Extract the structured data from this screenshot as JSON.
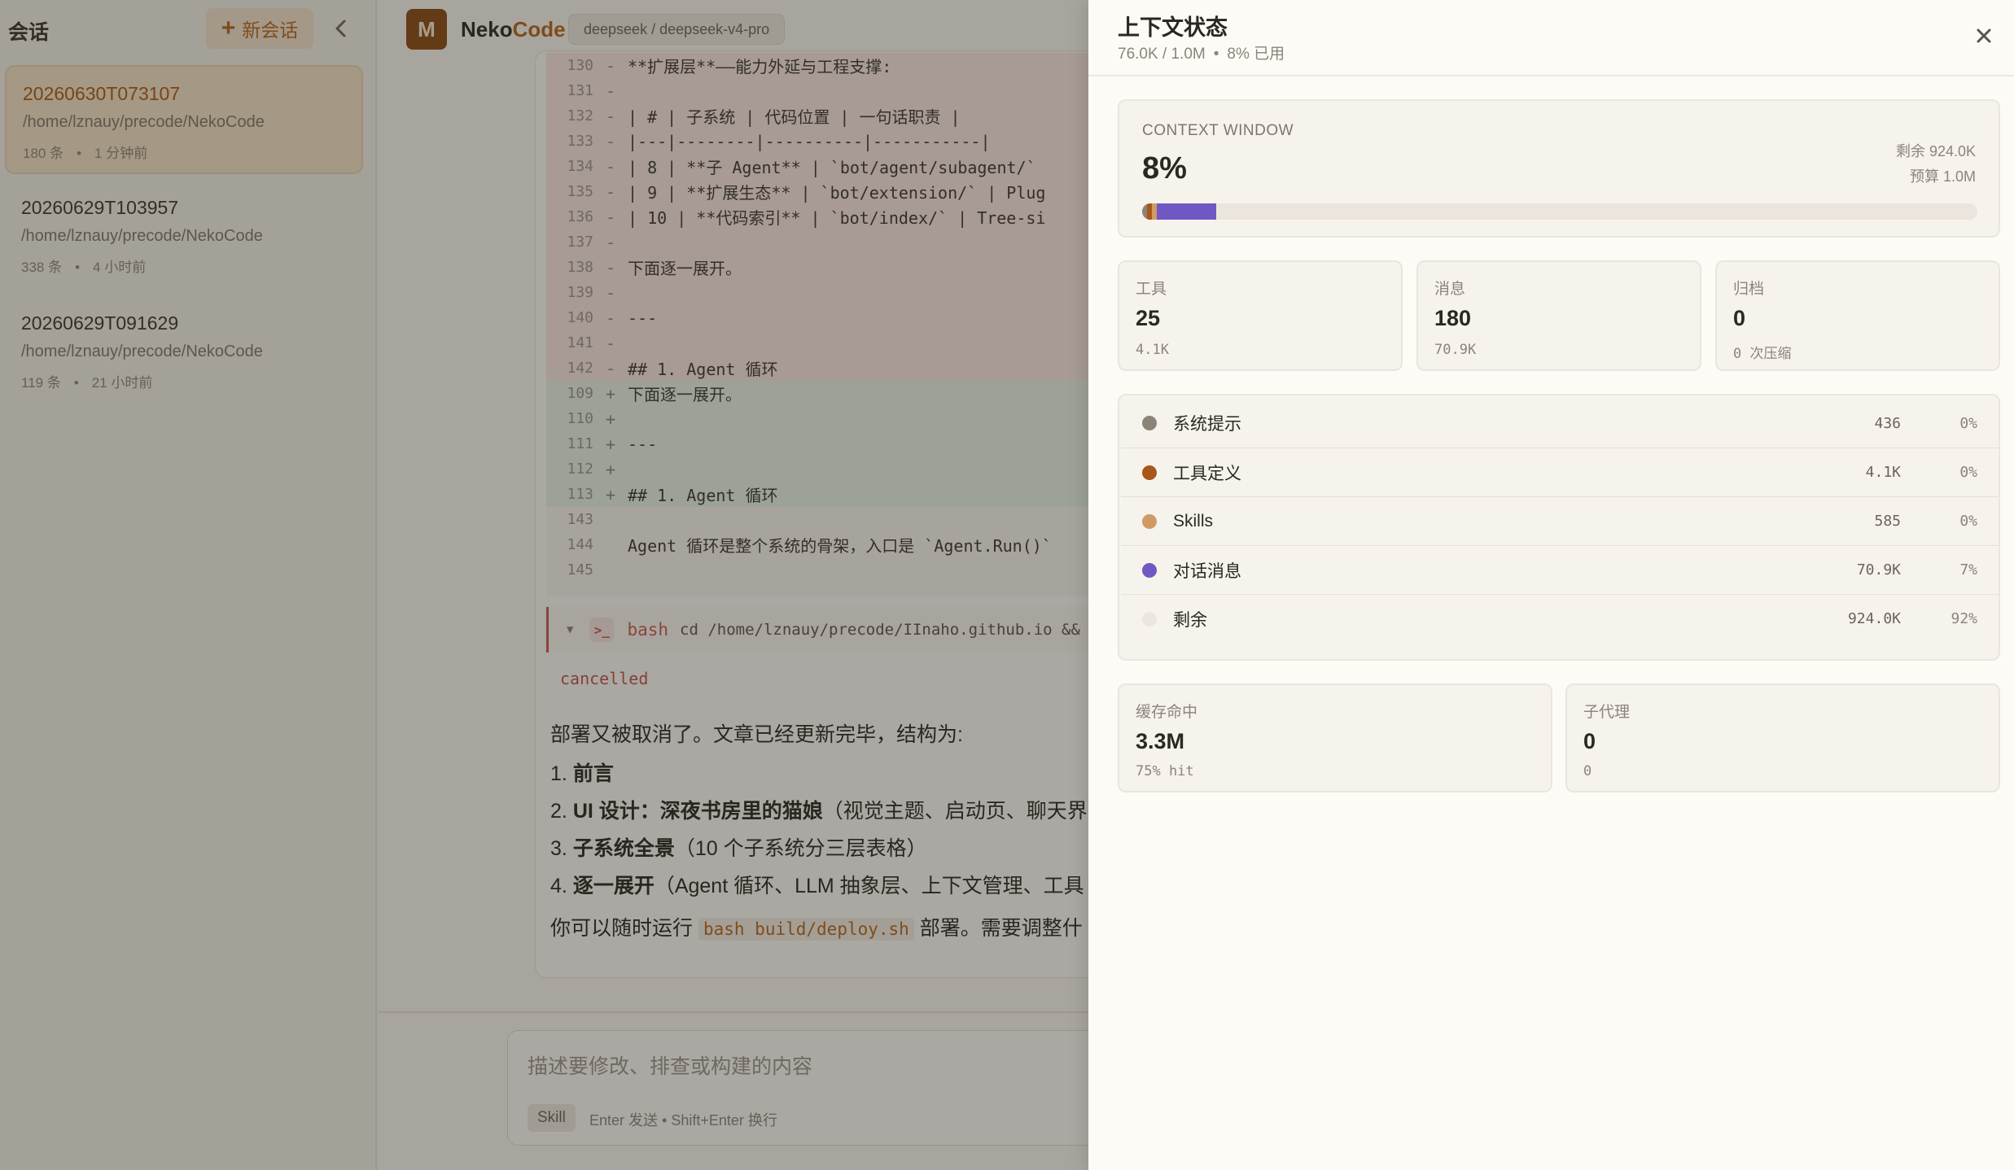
{
  "sidebar": {
    "title": "会话",
    "new_button": "新会话",
    "sessions": [
      {
        "title": "20260630T073107",
        "path": "/home/lznauy/precode/NekoCode",
        "count": "180 条",
        "time": "1 分钟前"
      },
      {
        "title": "20260629T103957",
        "path": "/home/lznauy/precode/NekoCode",
        "count": "338 条",
        "time": "4 小时前"
      },
      {
        "title": "20260629T091629",
        "path": "/home/lznauy/precode/NekoCode",
        "count": "119 条",
        "time": "21 小时前"
      }
    ]
  },
  "header": {
    "logo": "M",
    "brand_a": "Neko",
    "brand_b": "Code",
    "model": "deepseek / deepseek-v4-pro"
  },
  "diff": [
    {
      "ln": "130",
      "sign": "-",
      "code": "**扩展层**——能力外延与工程支撑:",
      "type": "del"
    },
    {
      "ln": "131",
      "sign": "-",
      "code": "",
      "type": "del"
    },
    {
      "ln": "132",
      "sign": "-",
      "code": "| # | 子系统 | 代码位置 | 一句话职责 |",
      "type": "del"
    },
    {
      "ln": "133",
      "sign": "-",
      "code": "|---|--------|----------|-----------|",
      "type": "del"
    },
    {
      "ln": "134",
      "sign": "-",
      "code": "| 8 | **子 Agent** | `bot/agent/subagent/`",
      "type": "del"
    },
    {
      "ln": "135",
      "sign": "-",
      "code": "| 9 | **扩展生态** | `bot/extension/` | Plug",
      "type": "del"
    },
    {
      "ln": "136",
      "sign": "-",
      "code": "| 10 | **代码索引** | `bot/index/` | Tree-si",
      "type": "del"
    },
    {
      "ln": "137",
      "sign": "-",
      "code": "",
      "type": "del"
    },
    {
      "ln": "138",
      "sign": "-",
      "code": "下面逐一展开。",
      "type": "del"
    },
    {
      "ln": "139",
      "sign": "-",
      "code": "",
      "type": "del"
    },
    {
      "ln": "140",
      "sign": "-",
      "code": "---",
      "type": "del"
    },
    {
      "ln": "141",
      "sign": "-",
      "code": "",
      "type": "del"
    },
    {
      "ln": "142",
      "sign": "-",
      "code": "## 1. Agent 循环",
      "type": "del"
    },
    {
      "ln": "109",
      "sign": "+",
      "code": "下面逐一展开。",
      "type": "add"
    },
    {
      "ln": "110",
      "sign": "+",
      "code": "",
      "type": "add"
    },
    {
      "ln": "111",
      "sign": "+",
      "code": "---",
      "type": "add"
    },
    {
      "ln": "112",
      "sign": "+",
      "code": "",
      "type": "add"
    },
    {
      "ln": "113",
      "sign": "+",
      "code": "## 1. Agent 循环",
      "type": "add"
    },
    {
      "ln": "143",
      "sign": "",
      "code": "",
      "type": "ctx"
    },
    {
      "ln": "144",
      "sign": "",
      "code": "Agent 循环是整个系统的骨架，入口是 `Agent.Run()`",
      "type": "ctx"
    },
    {
      "ln": "145",
      "sign": "",
      "code": "",
      "type": "ctx"
    }
  ],
  "tool": {
    "name": "bash",
    "command": "cd /home/lznauy/precode/IInaho.github.io &&",
    "status": "cancelled"
  },
  "answer": {
    "intro": "部署又被取消了。文章已经更新完毕，结构为:",
    "items": [
      {
        "num": "1.",
        "bold": "前言",
        "rest": ""
      },
      {
        "num": "2.",
        "bold": "UI 设计：深夜书房里的猫娘",
        "rest": "（视觉主题、启动页、聊天界"
      },
      {
        "num": "3.",
        "bold": "子系统全景",
        "rest": "（10 个子系统分三层表格）"
      },
      {
        "num": "4.",
        "bold": "逐一展开",
        "rest": "（Agent 循环、LLM 抽象层、上下文管理、工具"
      }
    ],
    "outro_pre": "你可以随时运行",
    "outro_code": "bash build/deploy.sh",
    "outro_post": "部署。需要调整什"
  },
  "composer": {
    "placeholder": "描述要修改、排查或构建的内容",
    "skill": "Skill",
    "hint": "Enter 发送 • Shift+Enter 换行"
  },
  "panel": {
    "title": "上下文状态",
    "used": "76.0K / 1.0M",
    "used_pct": "8% 已用",
    "close_icon": "close-icon",
    "window": {
      "label": "CONTEXT WINDOW",
      "percent": "8%",
      "remaining": "剩余 924.0K",
      "budget": "预算 1.0M",
      "segments": [
        {
          "name": "系统提示",
          "fraction": 0.0004,
          "color": "#8a8378"
        },
        {
          "name": "工具定义",
          "fraction": 0.0041,
          "color": "#a8561a"
        },
        {
          "name": "Skills",
          "fraction": 0.0006,
          "color": "#d19a65"
        },
        {
          "name": "对话消息",
          "fraction": 0.0709,
          "color": "#6f57c4"
        }
      ]
    },
    "stats": [
      {
        "label": "工具",
        "value": "25",
        "sub": "4.1K"
      },
      {
        "label": "消息",
        "value": "180",
        "sub": "70.9K"
      },
      {
        "label": "归档",
        "value": "0",
        "sub": "0 次压缩"
      }
    ],
    "breakdown": [
      {
        "name": "系统提示",
        "tokens": "436",
        "pct": "0%",
        "color": "#8a8378"
      },
      {
        "name": "工具定义",
        "tokens": "4.1K",
        "pct": "0%",
        "color": "#a8561a"
      },
      {
        "name": "Skills",
        "tokens": "585",
        "pct": "0%",
        "color": "#d19a65"
      },
      {
        "name": "对话消息",
        "tokens": "70.9K",
        "pct": "7%",
        "color": "#6f57c4"
      },
      {
        "name": "剩余",
        "tokens": "924.0K",
        "pct": "92%",
        "color": "#ebe6de"
      }
    ],
    "cache": {
      "label": "缓存命中",
      "value": "3.3M",
      "sub": "75% hit"
    },
    "subagent": {
      "label": "子代理",
      "value": "0",
      "sub": "0"
    }
  }
}
